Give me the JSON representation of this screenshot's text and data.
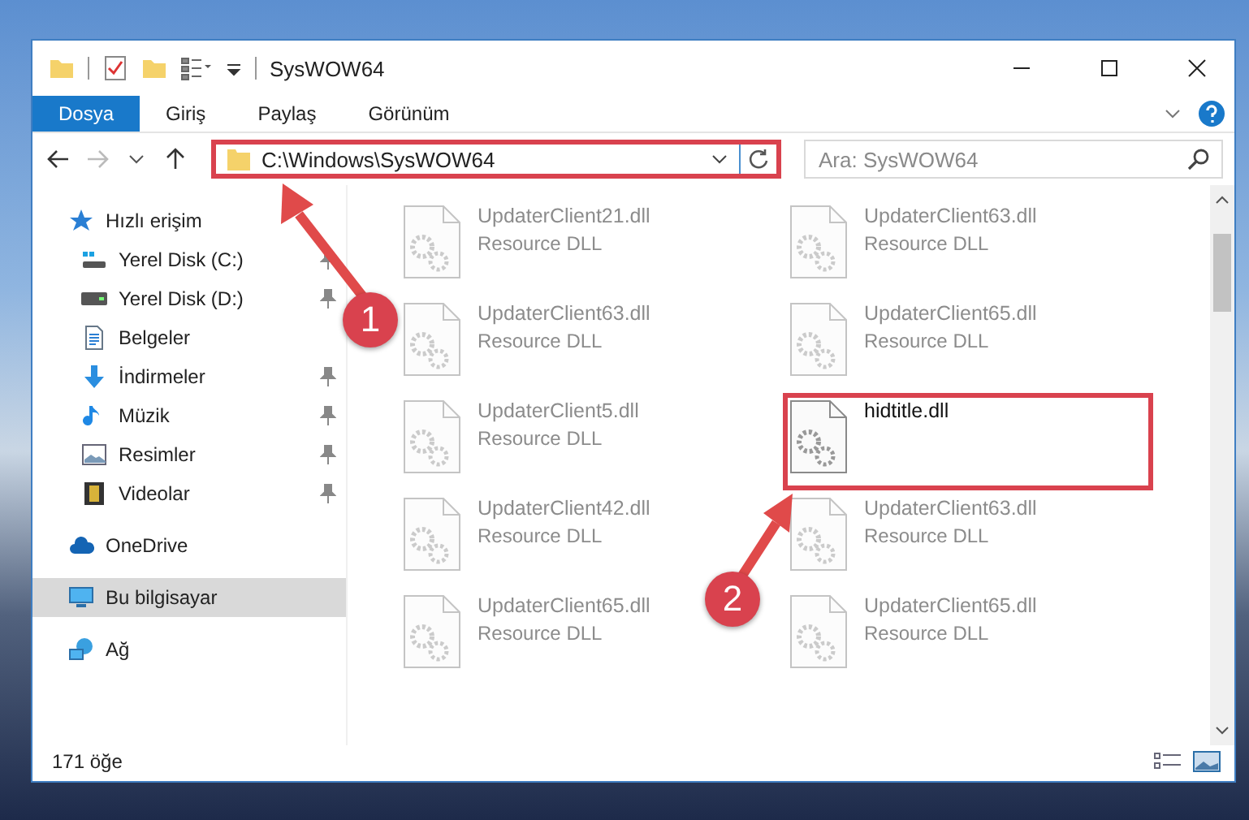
{
  "window": {
    "title": "SysWOW64"
  },
  "ribbon_tabs": [
    {
      "label": "Dosya",
      "selected": true
    },
    {
      "label": "Giriş",
      "selected": false
    },
    {
      "label": "Paylaş",
      "selected": false
    },
    {
      "label": "Görünüm",
      "selected": false
    }
  ],
  "address_bar": {
    "path": "C:\\Windows\\SysWOW64",
    "highlighted": true
  },
  "search": {
    "placeholder": "Ara: SysWOW64"
  },
  "sidebar": {
    "items": [
      {
        "label": "Hızlı erişim",
        "kind": "star",
        "selected": false,
        "children": [
          {
            "label": "Yerel Disk (C:)",
            "kind": "drive-win",
            "pinned": true
          },
          {
            "label": "Yerel Disk (D:)",
            "kind": "drive",
            "pinned": true
          },
          {
            "label": "Belgeler",
            "kind": "docs",
            "pinned": false
          },
          {
            "label": "İndirmeler",
            "kind": "download",
            "pinned": true
          },
          {
            "label": "Müzik",
            "kind": "music",
            "pinned": true
          },
          {
            "label": "Resimler",
            "kind": "pictures",
            "pinned": true
          },
          {
            "label": "Videolar",
            "kind": "video",
            "pinned": true
          }
        ]
      },
      {
        "label": "OneDrive",
        "kind": "cloud",
        "selected": false
      },
      {
        "label": "Bu bilgisayar",
        "kind": "pc",
        "selected": true
      },
      {
        "label": "Ağ",
        "kind": "network",
        "selected": false
      }
    ]
  },
  "files": [
    {
      "name": "UpdaterClient21.dll",
      "type": "Resource DLL",
      "blurred": true,
      "highlighted": false
    },
    {
      "name": "UpdaterClient63.dll",
      "type": "Resource DLL",
      "blurred": true,
      "highlighted": false
    },
    {
      "name": "UpdaterClient63.dll",
      "type": "Resource DLL",
      "blurred": true,
      "highlighted": false
    },
    {
      "name": "UpdaterClient65.dll",
      "type": "Resource DLL",
      "blurred": true,
      "highlighted": false
    },
    {
      "name": "UpdaterClient5.dll",
      "type": "Resource DLL",
      "blurred": true,
      "highlighted": false
    },
    {
      "name": "hidtitle.dll",
      "blurred": false,
      "highlighted": true
    },
    {
      "name": "UpdaterClient42.dll",
      "type": "Resource DLL",
      "blurred": true,
      "highlighted": false
    },
    {
      "name": "UpdaterClient63.dll",
      "type": "Resource DLL",
      "blurred": true,
      "highlighted": false
    },
    {
      "name": "UpdaterClient65.dll",
      "type": "Resource DLL",
      "blurred": true,
      "highlighted": false
    },
    {
      "name": "UpdaterClient65.dll",
      "type": "Resource DLL",
      "blurred": true,
      "highlighted": false
    }
  ],
  "status_bar": {
    "item_count": "171 öğe"
  },
  "annotations": [
    {
      "label": "1"
    },
    {
      "label": "2"
    }
  ]
}
